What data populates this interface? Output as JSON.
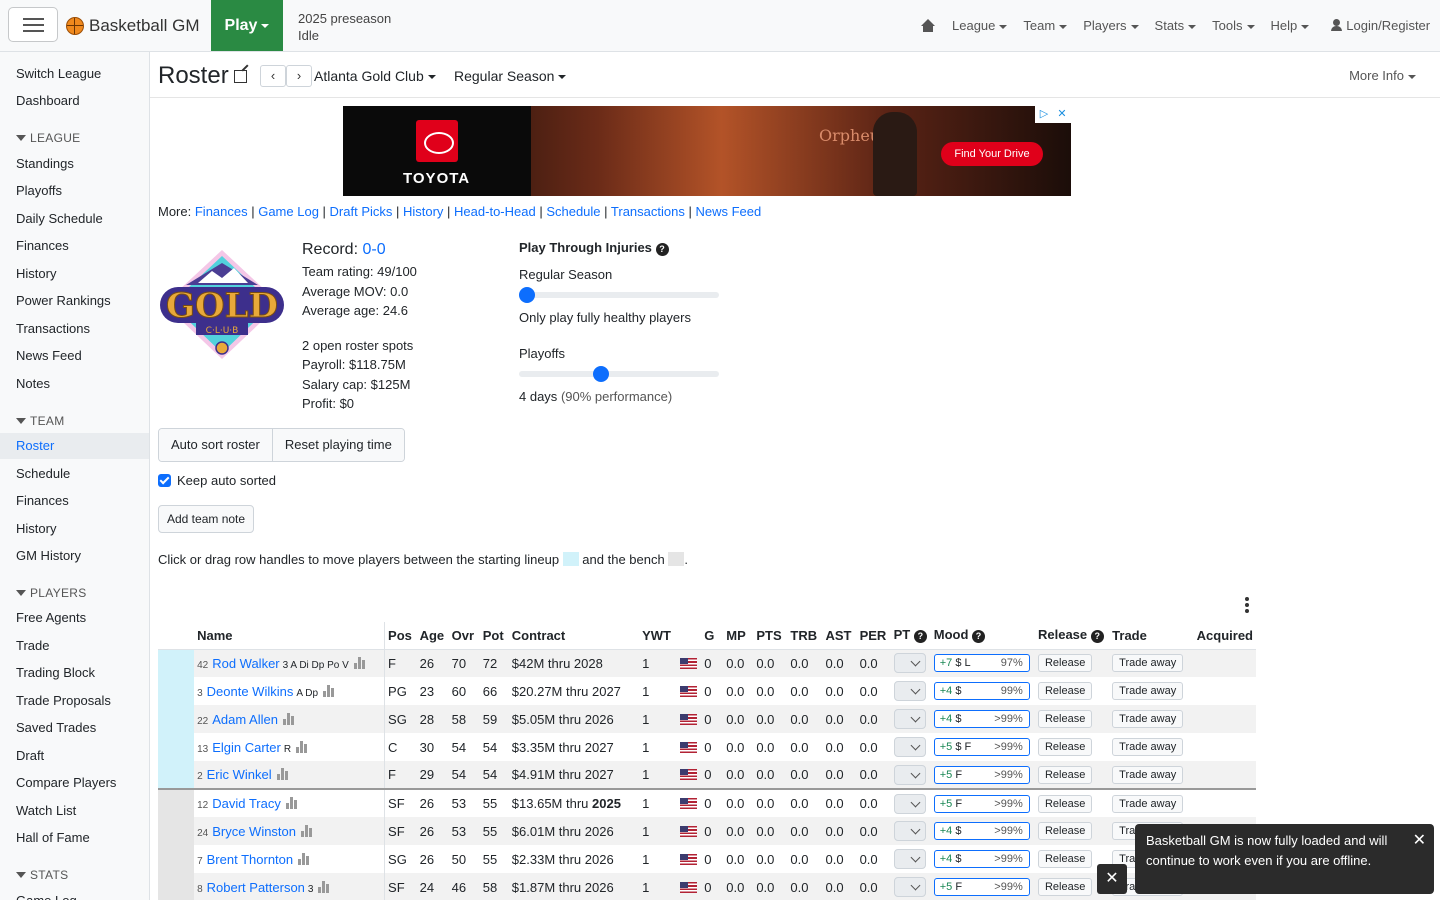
{
  "navbar": {
    "brand": "Basketball GM",
    "play": "Play",
    "season": "2025 preseason",
    "status": "Idle",
    "menus": [
      "League",
      "Team",
      "Players",
      "Stats",
      "Tools",
      "Help"
    ],
    "login": "Login/Register"
  },
  "sidebar": {
    "top": [
      "Switch League",
      "Dashboard"
    ],
    "league_head": "LEAGUE",
    "league": [
      "Standings",
      "Playoffs",
      "Daily Schedule",
      "Finances",
      "History",
      "Power Rankings",
      "Transactions",
      "News Feed",
      "Notes"
    ],
    "team_head": "TEAM",
    "team": [
      "Roster",
      "Schedule",
      "Finances",
      "History",
      "GM History"
    ],
    "players_head": "PLAYERS",
    "players": [
      "Free Agents",
      "Trade",
      "Trading Block",
      "Trade Proposals",
      "Saved Trades",
      "Draft",
      "Compare Players",
      "Watch List",
      "Hall of Fame"
    ],
    "stats_head": "STATS",
    "stats": [
      "Game Log"
    ]
  },
  "header": {
    "title": "Roster",
    "team": "Atlanta Gold Club",
    "season_type": "Regular Season",
    "more_info": "More Info"
  },
  "ad": {
    "brand": "TOYOTA",
    "sign": "Orpheum",
    "cta": "Find Your Drive"
  },
  "more": {
    "label": "More:",
    "links": [
      "Finances",
      "Game Log",
      "Draft Picks",
      "History",
      "Head-to-Head",
      "Schedule",
      "Transactions",
      "News Feed"
    ]
  },
  "team_info": {
    "logo_text": "GOLD",
    "logo_sub": "C·L·U·B",
    "record_label": "Record:",
    "record": "0-0",
    "rating": "Team rating: 49/100",
    "mov": "Average MOV: 0.0",
    "age": "Average age: 24.6",
    "roster_spots": "2 open roster spots",
    "payroll": "Payroll: $118.75M",
    "cap": "Salary cap: $125M",
    "profit": "Profit: $0"
  },
  "injuries": {
    "title": "Play Through Injuries",
    "regular_label": "Regular Season",
    "regular_value": 0,
    "regular_text": "Only play fully healthy players",
    "playoffs_label": "Playoffs",
    "playoffs_value": 4,
    "playoffs_days": "4 days",
    "playoffs_perf": "(90% performance)"
  },
  "controls": {
    "auto_sort": "Auto sort roster",
    "reset_pt": "Reset playing time",
    "keep_sorted": "Keep auto sorted",
    "team_note": "Add team note",
    "hint_a": "Click or drag row handles to move players between the starting lineup",
    "hint_b": "and the bench",
    "hint_c": "."
  },
  "table": {
    "headers": [
      "Name",
      "Pos",
      "Age",
      "Ovr",
      "Pot",
      "Contract",
      "YWT",
      "G",
      "MP",
      "PTS",
      "TRB",
      "AST",
      "PER",
      "PT",
      "Mood",
      "Release",
      "Trade",
      "Acquired"
    ],
    "release_label": "Release",
    "trade_label": "Trade away",
    "rows": [
      {
        "num": "42",
        "name": "Rod Walker",
        "skills": "3 A Di Dp Po V",
        "pos": "F",
        "age": "26",
        "ovr": "70",
        "pot": "72",
        "contract": "$42M thru 2028",
        "ywt": "1",
        "g": "0",
        "mp": "0.0",
        "pts": "0.0",
        "trb": "0.0",
        "ast": "0.0",
        "per": "0.0",
        "mood_delta": "+7",
        "mood_traits": "$ L",
        "mood_pct": "97%",
        "starter": true
      },
      {
        "num": "3",
        "name": "Deonte Wilkins",
        "skills": "A Dp",
        "pos": "PG",
        "age": "23",
        "ovr": "60",
        "pot": "66",
        "contract": "$20.27M thru 2027",
        "ywt": "1",
        "g": "0",
        "mp": "0.0",
        "pts": "0.0",
        "trb": "0.0",
        "ast": "0.0",
        "per": "0.0",
        "mood_delta": "+4",
        "mood_traits": "$",
        "mood_pct": "99%",
        "starter": true
      },
      {
        "num": "22",
        "name": "Adam Allen",
        "skills": "",
        "pos": "SG",
        "age": "28",
        "ovr": "58",
        "pot": "59",
        "contract": "$5.05M thru 2026",
        "ywt": "1",
        "g": "0",
        "mp": "0.0",
        "pts": "0.0",
        "trb": "0.0",
        "ast": "0.0",
        "per": "0.0",
        "mood_delta": "+4",
        "mood_traits": "$",
        "mood_pct": ">99%",
        "starter": true
      },
      {
        "num": "13",
        "name": "Elgin Carter",
        "skills": "R",
        "pos": "C",
        "age": "30",
        "ovr": "54",
        "pot": "54",
        "contract": "$3.35M thru 2027",
        "ywt": "1",
        "g": "0",
        "mp": "0.0",
        "pts": "0.0",
        "trb": "0.0",
        "ast": "0.0",
        "per": "0.0",
        "mood_delta": "+5",
        "mood_traits": "$ F",
        "mood_pct": ">99%",
        "starter": true
      },
      {
        "num": "2",
        "name": "Eric Winkel",
        "skills": "",
        "pos": "F",
        "age": "29",
        "ovr": "54",
        "pot": "54",
        "contract": "$4.91M thru 2027",
        "ywt": "1",
        "g": "0",
        "mp": "0.0",
        "pts": "0.0",
        "trb": "0.0",
        "ast": "0.0",
        "per": "0.0",
        "mood_delta": "+5",
        "mood_traits": "F",
        "mood_pct": ">99%",
        "starter": true
      },
      {
        "num": "12",
        "name": "David Tracy",
        "skills": "",
        "pos": "SF",
        "age": "26",
        "ovr": "53",
        "pot": "55",
        "contract": "$13.65M thru",
        "contract_bold": "2025",
        "ywt": "1",
        "g": "0",
        "mp": "0.0",
        "pts": "0.0",
        "trb": "0.0",
        "ast": "0.0",
        "per": "0.0",
        "mood_delta": "+5",
        "mood_traits": "F",
        "mood_pct": ">99%",
        "starter": false
      },
      {
        "num": "24",
        "name": "Bryce Winston",
        "skills": "",
        "pos": "SF",
        "age": "26",
        "ovr": "53",
        "pot": "55",
        "contract": "$6.01M thru 2026",
        "ywt": "1",
        "g": "0",
        "mp": "0.0",
        "pts": "0.0",
        "trb": "0.0",
        "ast": "0.0",
        "per": "0.0",
        "mood_delta": "+4",
        "mood_traits": "$",
        "mood_pct": ">99%",
        "starter": false
      },
      {
        "num": "7",
        "name": "Brent Thornton",
        "skills": "",
        "pos": "SG",
        "age": "26",
        "ovr": "50",
        "pot": "55",
        "contract": "$2.33M thru 2026",
        "ywt": "1",
        "g": "0",
        "mp": "0.0",
        "pts": "0.0",
        "trb": "0.0",
        "ast": "0.0",
        "per": "0.0",
        "mood_delta": "+4",
        "mood_traits": "$",
        "mood_pct": ">99%",
        "starter": false
      },
      {
        "num": "8",
        "name": "Robert Patterson",
        "skills": "3",
        "pos": "SF",
        "age": "24",
        "ovr": "46",
        "pot": "58",
        "contract": "$1.87M thru 2026",
        "ywt": "1",
        "g": "0",
        "mp": "0.0",
        "pts": "0.0",
        "trb": "0.0",
        "ast": "0.0",
        "per": "0.0",
        "mood_delta": "+5",
        "mood_traits": "F",
        "mood_pct": ">99%",
        "starter": false
      }
    ]
  },
  "toast": {
    "message": "Basketball GM is now fully loaded and will continue to work even if you are offline."
  },
  "colors": {
    "play": "#2a8a43",
    "link": "#0d6efd",
    "starter": "#d1f2fa",
    "bench": "#e5e5e5"
  }
}
